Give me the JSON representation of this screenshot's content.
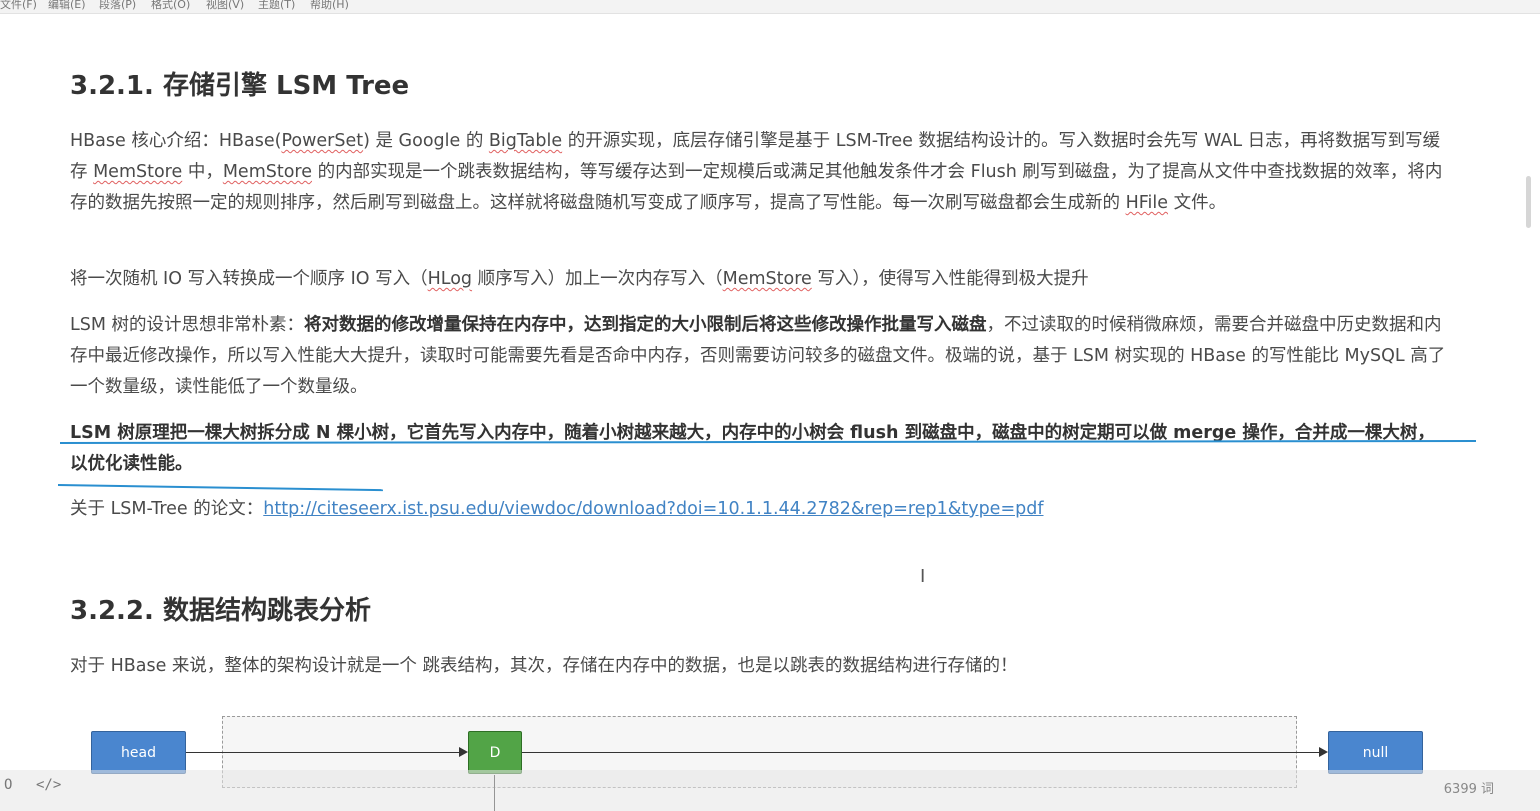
{
  "menu": [
    "文件(F)",
    "编辑(E)",
    "段落(P)",
    "格式(O)",
    "视图(V)",
    "主题(T)",
    "帮助(H)"
  ],
  "section1": {
    "title": "3.2.1. 存储引擎 LSM Tree",
    "p1": {
      "t1": "HBase 核心介绍：HBase(",
      "w1": "PowerSet",
      "t2": ") 是 Google 的 ",
      "w2": "BigTable",
      "t3": " 的开源实现，底层存储引擎是基于 LSM-Tree 数据结构设计的。写入数据时会先写 WAL 日志，再将数据写到写缓存 ",
      "w3": "MemStore",
      "t4": " 中，",
      "w4": "MemStore",
      "t5": " 的内部实现是一个跳表数据结构，等写缓存达到一定规模后或满足其他触发条件才会 Flush 刷写到磁盘，为了提高从文件中查找数据的效率，将内存的数据先按照一定的规则排序，然后刷写到磁盘上。这样就将磁盘随机写变成了顺序写，提高了写性能。每一次刷写磁盘都会生成新的 ",
      "w5": "HFile",
      "t6": " 文件。"
    },
    "p2": {
      "t1": "将一次随机 IO 写入转换成一个顺序 IO 写入（",
      "w1": "HLog",
      "t2": " 顺序写入）加上一次内存写入（",
      "w2": "MemStore",
      "t3": " 写入），使得写入性能得到极大提升"
    },
    "p3": {
      "t1": "LSM 树的设计思想非常朴素：",
      "bold": "将对数据的修改增量保持在内存中，达到指定的大小限制后将这些修改操作批量写入磁盘",
      "t2": "，不过读取的时候稍微麻烦，需要合并磁盘中历史数据和内存中最近修改操作，所以写入性能大大提升，读取时可能需要先看是否命中内存，否则需要访问较多的磁盘文件。极端的说，基于 LSM 树实现的 HBase 的写性能比 MySQL 高了一个数量级，读性能低了一个数量级。"
    },
    "p4": "LSM 树原理把一棵大树拆分成 N 棵小树，它首先写入内存中，随着小树越来越大，内存中的小树会 flush 到磁盘中，磁盘中的树定期可以做 merge 操作，合并成一棵大树，以优化读性能。",
    "p5": {
      "label": "关于 LSM-Tree 的论文：",
      "url": "http://citeseerx.ist.psu.edu/viewdoc/download?doi=10.1.1.44.2782&rep=rep1&type=pdf"
    }
  },
  "section2": {
    "title": "3.2.2. 数据结构跳表分析",
    "p1": "对于 HBase 来说，整体的架构设计就是一个 跳表结构，其次，存储在内存中的数据，也是以跳表的数据结构进行存储的！"
  },
  "diagram": {
    "head": "head",
    "node": "D",
    "null": "null"
  },
  "status": {
    "word_count": "6399 词",
    "left_icon": "O",
    "source_icon": "</>"
  },
  "colors": {
    "accent_link": "#4183c4",
    "node_blue": "#4a86cf",
    "node_green": "#52a447",
    "ink": "#2a8fd0"
  }
}
